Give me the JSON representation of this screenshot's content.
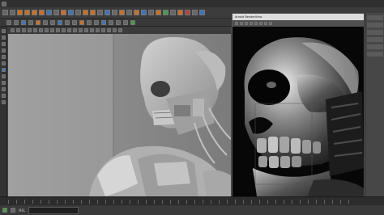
{
  "render_view": {
    "title": "Arnold RenderView"
  },
  "viewport": {
    "subject": "gray sculpted skull-faced figure"
  },
  "render": {
    "subject": "metallic skull close-up render"
  },
  "statusbar": {
    "left_label": "MEL"
  }
}
